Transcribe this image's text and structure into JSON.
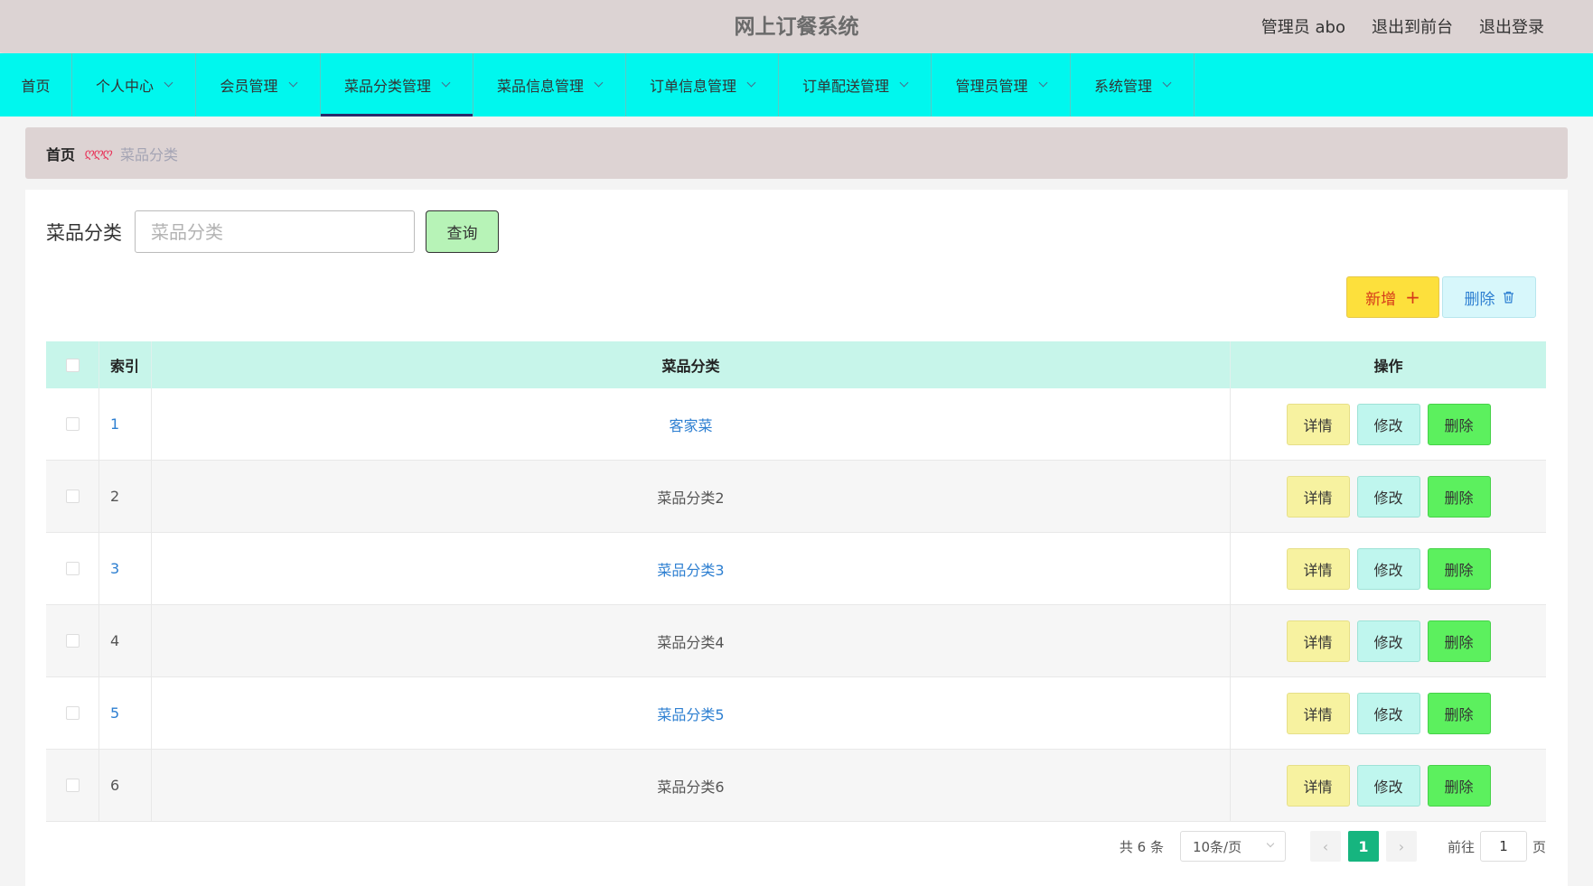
{
  "header": {
    "title": "网上订餐系统",
    "user": "管理员 abo",
    "to_front": "退出到前台",
    "logout": "退出登录"
  },
  "nav": {
    "items": [
      {
        "label": "首页",
        "has_dropdown": false,
        "active": false
      },
      {
        "label": "个人中心",
        "has_dropdown": true,
        "active": false
      },
      {
        "label": "会员管理",
        "has_dropdown": true,
        "active": false
      },
      {
        "label": "菜品分类管理",
        "has_dropdown": true,
        "active": true
      },
      {
        "label": "菜品信息管理",
        "has_dropdown": true,
        "active": false
      },
      {
        "label": "订单信息管理",
        "has_dropdown": true,
        "active": false
      },
      {
        "label": "订单配送管理",
        "has_dropdown": true,
        "active": false
      },
      {
        "label": "管理员管理",
        "has_dropdown": true,
        "active": false
      },
      {
        "label": "系统管理",
        "has_dropdown": true,
        "active": false
      }
    ]
  },
  "breadcrumb": {
    "home": "首页",
    "separator": "ღღღ",
    "current": "菜品分类"
  },
  "search": {
    "label": "菜品分类",
    "placeholder": "菜品分类",
    "value": "",
    "button": "查询"
  },
  "actions": {
    "add": "新增",
    "add_icon": "+",
    "delete": "删除"
  },
  "table": {
    "headers": {
      "index": "索引",
      "name": "菜品分类",
      "ops": "操作"
    },
    "rows": [
      {
        "index": "1",
        "name": "客家菜",
        "highlight": true
      },
      {
        "index": "2",
        "name": "菜品分类2",
        "highlight": false
      },
      {
        "index": "3",
        "name": "菜品分类3",
        "highlight": true
      },
      {
        "index": "4",
        "name": "菜品分类4",
        "highlight": false
      },
      {
        "index": "5",
        "name": "菜品分类5",
        "highlight": true
      },
      {
        "index": "6",
        "name": "菜品分类6",
        "highlight": false
      }
    ],
    "op_labels": {
      "detail": "详情",
      "edit": "修改",
      "delete": "删除"
    }
  },
  "pager": {
    "total": "共 6 条",
    "page_size": "10条/页",
    "current": "1",
    "goto_label": "前往",
    "goto_value": "1",
    "page_suffix": "页"
  },
  "colors": {
    "nav_bg": "#00f7ee",
    "header_bg": "#dcd3d3",
    "table_head_bg": "#c7f5ea",
    "link_blue": "#2d7fd1",
    "pager_active": "#16b57f"
  }
}
